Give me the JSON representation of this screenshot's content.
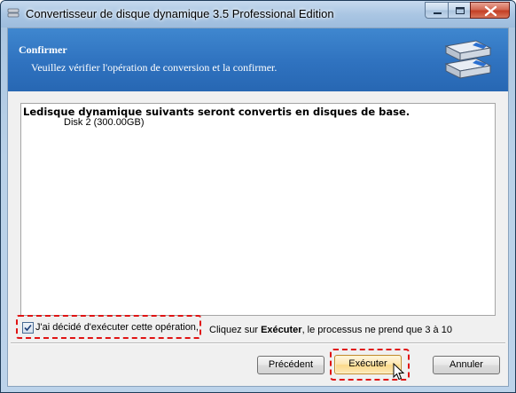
{
  "window": {
    "title": "Convertisseur de disque dynamique 3.5 Professional Edition"
  },
  "header": {
    "title": "Confirmer",
    "subtitle": "Veuillez vérifier l'opération de conversion et la confirmer.",
    "icon": "disks-icon"
  },
  "content": {
    "heading": "Ledisque dynamique suivants seront convertis en disques de base.",
    "items": [
      "Disk 2 (300.00GB)"
    ]
  },
  "confirm": {
    "checked": true,
    "label": "J'ai décidé d'exécuter cette opération,"
  },
  "hint": {
    "prefix": "Cliquez sur ",
    "bold": "Exécuter",
    "suffix": ", le processus ne prend que 3 à 10"
  },
  "buttons": {
    "previous": "Précédent",
    "execute": "Exécuter",
    "cancel": "Annuler"
  },
  "colors": {
    "header_band": "#2f72bf",
    "highlight_dashed": "#e01414",
    "execute_button": "#fbd98a"
  }
}
